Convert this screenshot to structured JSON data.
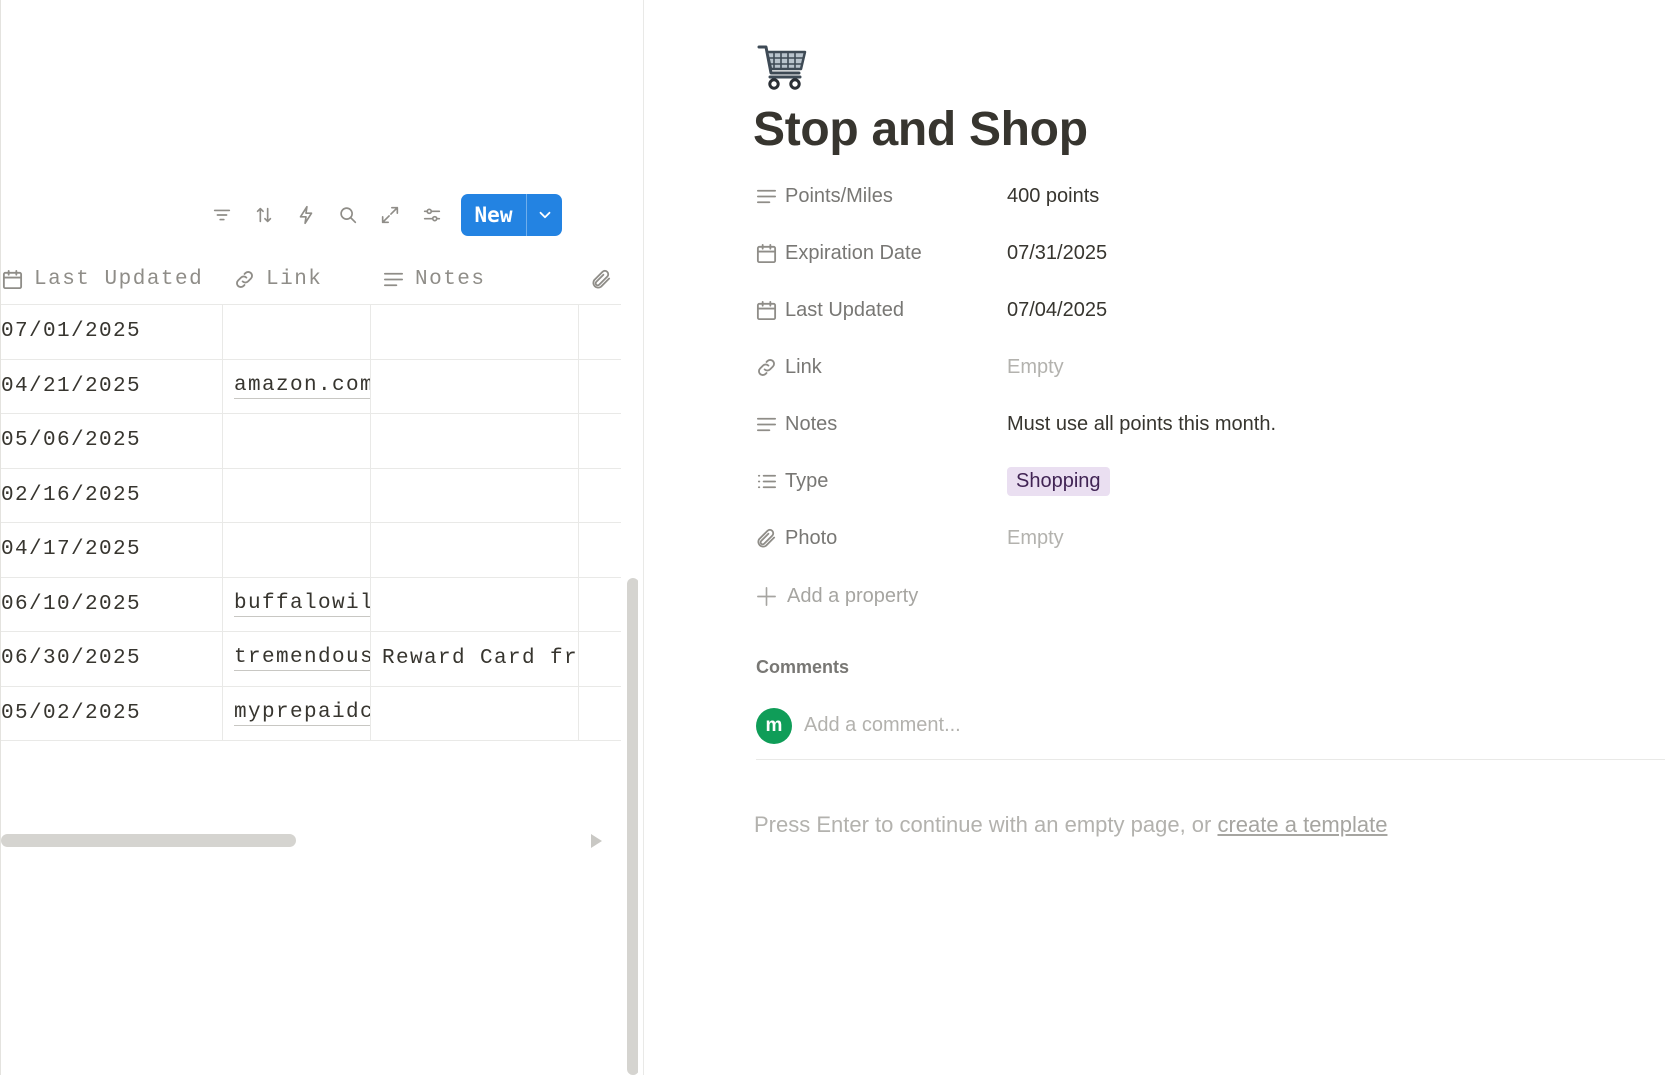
{
  "table": {
    "columns": {
      "last_updated": "Last Updated",
      "link": "Link",
      "notes": "Notes"
    },
    "rows": [
      {
        "last_updated": "07/01/2025",
        "link": "",
        "notes": ""
      },
      {
        "last_updated": "04/21/2025",
        "link": "amazon.com",
        "notes": ""
      },
      {
        "last_updated": "05/06/2025",
        "link": "",
        "notes": ""
      },
      {
        "last_updated": "02/16/2025",
        "link": "",
        "notes": ""
      },
      {
        "last_updated": "04/17/2025",
        "link": "",
        "notes": ""
      },
      {
        "last_updated": "06/10/2025",
        "link": "buffalowil",
        "notes": ""
      },
      {
        "last_updated": "06/30/2025",
        "link": "tremendous",
        "notes": "Reward Card fro"
      },
      {
        "last_updated": "05/02/2025",
        "link": "myprepaidc",
        "notes": ""
      }
    ]
  },
  "toolbar": {
    "new_label": "New",
    "icons": [
      "filter-icon",
      "sort-icon",
      "automation-icon",
      "search-icon",
      "expand-icon",
      "settings-icon"
    ]
  },
  "page": {
    "icon": "shopping-cart-icon",
    "title": "Stop and Shop",
    "properties": {
      "points": {
        "label": "Points/Miles",
        "value": "400 points"
      },
      "expiration": {
        "label": "Expiration Date",
        "value": "07/31/2025"
      },
      "last_updated": {
        "label": "Last Updated",
        "value": "07/04/2025"
      },
      "link": {
        "label": "Link",
        "value": "Empty"
      },
      "notes": {
        "label": "Notes",
        "value": "Must use all points this month."
      },
      "type": {
        "label": "Type",
        "value": "Shopping"
      },
      "photo": {
        "label": "Photo",
        "value": "Empty"
      }
    },
    "add_property": "Add a property",
    "comments_label": "Comments",
    "avatar_initial": "m",
    "comment_placeholder": "Add a comment...",
    "empty_hint_prefix": "Press Enter to continue with an empty page, or ",
    "empty_hint_link": "create a template"
  },
  "colors": {
    "accent": "#2383e2",
    "tag_bg": "#eadff1",
    "avatar": "#0f9d58"
  }
}
